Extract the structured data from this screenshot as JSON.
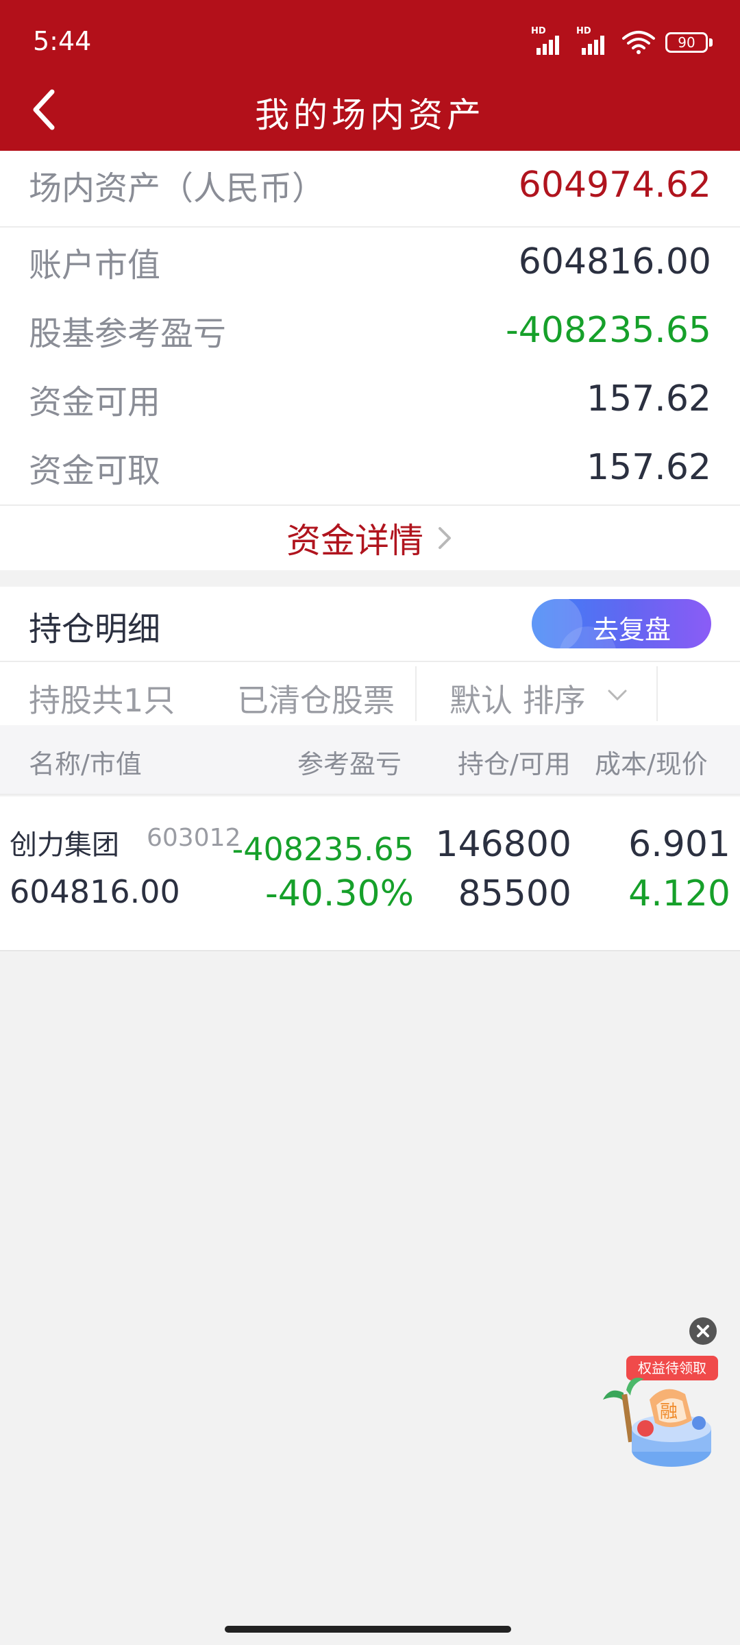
{
  "status_bar": {
    "time": "5:44",
    "battery": "90",
    "signal_tag": "HD"
  },
  "header": {
    "title": "我的场内资产"
  },
  "summary": {
    "total_label": "场内资产（人民币）",
    "total_value": "604974.62",
    "market_value_label": "账户市值",
    "market_value": "604816.00",
    "pl_label": "股基参考盈亏",
    "pl_value": "-408235.65",
    "available_label": "资金可用",
    "available_value": "157.62",
    "withdrawable_label": "资金可取",
    "withdrawable_value": "157.62",
    "detail_link": "资金详情"
  },
  "holdings": {
    "title": "持仓明细",
    "review_button": "去复盘",
    "filters": {
      "count": "持股共1只",
      "cleared": "已清仓股票",
      "sort": "默认 排序"
    },
    "columns": {
      "name": "名称/市值",
      "pl": "参考盈亏",
      "position": "持仓/可用",
      "cost": "成本/现价"
    },
    "rows": [
      {
        "name": "创力集团",
        "code": "603012",
        "market_value": "604816.00",
        "pl": "-408235.65",
        "pl_pct": "-40.30%",
        "holding": "146800",
        "available": "85500",
        "cost": "6.901",
        "price": "4.120"
      }
    ]
  },
  "promo": {
    "tag": "权益待领取",
    "badge": "融"
  },
  "colors": {
    "header": "#b3101a",
    "up_red": "#b0141e",
    "down_green": "#16a02a"
  }
}
